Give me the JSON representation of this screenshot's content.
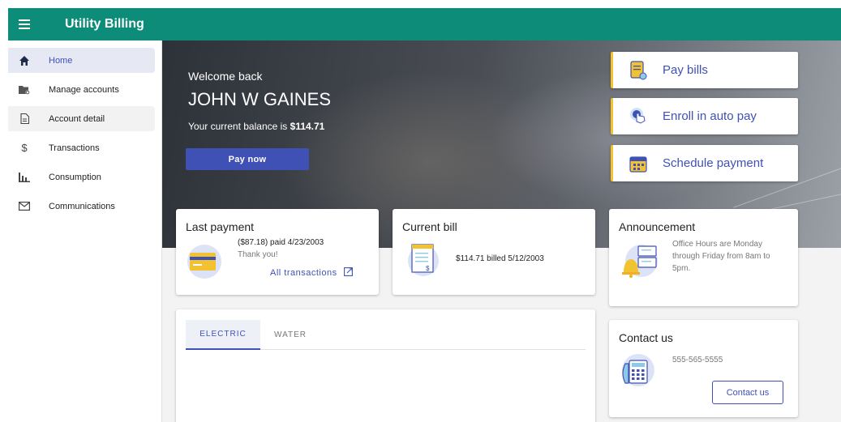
{
  "header": {
    "title": "Utility Billing",
    "menu_icon": "menu-icon"
  },
  "sidebar": {
    "items": [
      {
        "label": "Home",
        "icon": "home-icon"
      },
      {
        "label": "Manage accounts",
        "icon": "folder-settings-icon"
      },
      {
        "label": "Account detail",
        "icon": "document-icon"
      },
      {
        "label": "Transactions",
        "icon": "dollar-icon"
      },
      {
        "label": "Consumption",
        "icon": "bar-chart-icon"
      },
      {
        "label": "Communications",
        "icon": "mail-icon"
      }
    ]
  },
  "hero": {
    "welcome": "Welcome back",
    "customer_name": "JOHN W GAINES",
    "balance_prefix": "Your current balance is ",
    "balance_amount": "$114.71",
    "pay_now_label": "Pay now"
  },
  "quick_actions": [
    {
      "label": "Pay bills",
      "icon": "bill-icon"
    },
    {
      "label": "Enroll in auto pay",
      "icon": "touch-icon"
    },
    {
      "label": "Schedule payment",
      "icon": "calendar-icon"
    }
  ],
  "last_payment": {
    "title": "Last payment",
    "amount_line": "($87.18) paid 4/23/2003",
    "note": "Thank you!",
    "link": "All transactions"
  },
  "current_bill": {
    "title": "Current bill",
    "line": "$114.71 billed 5/12/2003"
  },
  "announcement": {
    "title": "Announcement",
    "text": "Office Hours are Monday through Friday from 8am to 5pm."
  },
  "usage": {
    "tabs": [
      "ELECTRIC",
      "WATER"
    ],
    "active_tab": "ELECTRIC"
  },
  "contact": {
    "title": "Contact us",
    "phone": "555-565-5555",
    "button": "Contact us"
  },
  "colors": {
    "topbar": "#0e8c7a",
    "primary": "#3f51b5",
    "accent": "#f2c230"
  }
}
